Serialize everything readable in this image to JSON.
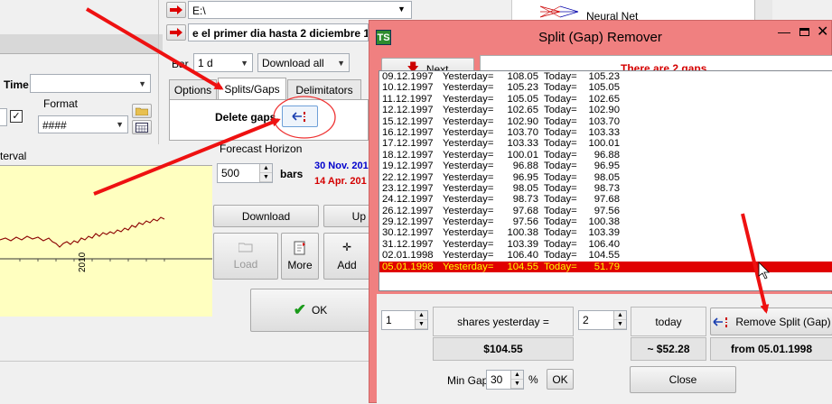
{
  "main": {
    "path_value": "E:\\",
    "range_text": "e el primer dia hasta 2 diciembre 12",
    "bar_label": "Bar",
    "bar_value": "1 d",
    "download_mode": "Download all",
    "time_label": "Time",
    "format_label": "Format",
    "format_value": "####",
    "tabs": [
      "Options",
      "Splits/Gaps",
      "Delimitators"
    ],
    "delete_gaps_label": "Delete gaps",
    "forecast_label": "Forecast Horizon",
    "bars_value": "500",
    "bars_label": "bars",
    "date_blue": "30 Nov. 201",
    "date_red": "14 Apr. 201",
    "interval_label": "terval",
    "download_button": "Download",
    "up_button": "Up",
    "load_button": "Load",
    "more_button": "More",
    "add_button": "Add",
    "ok_button": "OK",
    "chart_year": "2010",
    "neural_net_label": "Neural Net"
  },
  "dialog": {
    "title": "Split (Gap) Remover",
    "next_button": "Next",
    "gap_message": "There are 2 gaps",
    "rows": [
      {
        "date": "09.12.1997",
        "y_label": "Yesterday=",
        "y": "108.05",
        "t_label": "Today=",
        "t": "105.23"
      },
      {
        "date": "10.12.1997",
        "y_label": "Yesterday=",
        "y": "105.23",
        "t_label": "Today=",
        "t": "105.05"
      },
      {
        "date": "11.12.1997",
        "y_label": "Yesterday=",
        "y": "105.05",
        "t_label": "Today=",
        "t": "102.65"
      },
      {
        "date": "12.12.1997",
        "y_label": "Yesterday=",
        "y": "102.65",
        "t_label": "Today=",
        "t": "102.90"
      },
      {
        "date": "15.12.1997",
        "y_label": "Yesterday=",
        "y": "102.90",
        "t_label": "Today=",
        "t": "103.70"
      },
      {
        "date": "16.12.1997",
        "y_label": "Yesterday=",
        "y": "103.70",
        "t_label": "Today=",
        "t": "103.33"
      },
      {
        "date": "17.12.1997",
        "y_label": "Yesterday=",
        "y": "103.33",
        "t_label": "Today=",
        "t": "100.01"
      },
      {
        "date": "18.12.1997",
        "y_label": "Yesterday=",
        "y": "100.01",
        "t_label": "Today=",
        "t": "96.88"
      },
      {
        "date": "19.12.1997",
        "y_label": "Yesterday=",
        "y": "96.88",
        "t_label": "Today=",
        "t": "96.95"
      },
      {
        "date": "22.12.1997",
        "y_label": "Yesterday=",
        "y": "96.95",
        "t_label": "Today=",
        "t": "98.05"
      },
      {
        "date": "23.12.1997",
        "y_label": "Yesterday=",
        "y": "98.05",
        "t_label": "Today=",
        "t": "98.73"
      },
      {
        "date": "24.12.1997",
        "y_label": "Yesterday=",
        "y": "98.73",
        "t_label": "Today=",
        "t": "97.68"
      },
      {
        "date": "26.12.1997",
        "y_label": "Yesterday=",
        "y": "97.68",
        "t_label": "Today=",
        "t": "97.56"
      },
      {
        "date": "29.12.1997",
        "y_label": "Yesterday=",
        "y": "97.56",
        "t_label": "Today=",
        "t": "100.38"
      },
      {
        "date": "30.12.1997",
        "y_label": "Yesterday=",
        "y": "100.38",
        "t_label": "Today=",
        "t": "103.39"
      },
      {
        "date": "31.12.1997",
        "y_label": "Yesterday=",
        "y": "103.39",
        "t_label": "Today=",
        "t": "106.40"
      },
      {
        "date": "02.01.1998",
        "y_label": "Yesterday=",
        "y": "106.40",
        "t_label": "Today=",
        "t": "104.55"
      },
      {
        "date": "05.01.1998",
        "y_label": "Yesterday=",
        "y": "104.55",
        "t_label": "Today=",
        "t": "51.79"
      }
    ],
    "left_spin": "1",
    "shares_yesterday_label": "shares yesterday =",
    "right_spin": "2",
    "today_label": "today",
    "remove_button": "Remove Split (Gap)",
    "price_yesterday": "$104.55",
    "price_today": "~ $52.28",
    "from_date": "from 05.01.1998",
    "min_gap_label": "Min Gap",
    "min_gap_value": "30",
    "percent_label": "%",
    "ok_button": "OK",
    "close_button": "Close"
  },
  "colors": {
    "dialog_frame": "#f08080",
    "message_red": "#d40000",
    "selected_row": "#e00000",
    "selected_text": "#ffff00",
    "chart_bg": "#ffffc0",
    "chart_line": "#8b0000",
    "annotation_arrow": "#ee1111",
    "date_blue": "#0000cc",
    "date_red": "#d40000"
  }
}
